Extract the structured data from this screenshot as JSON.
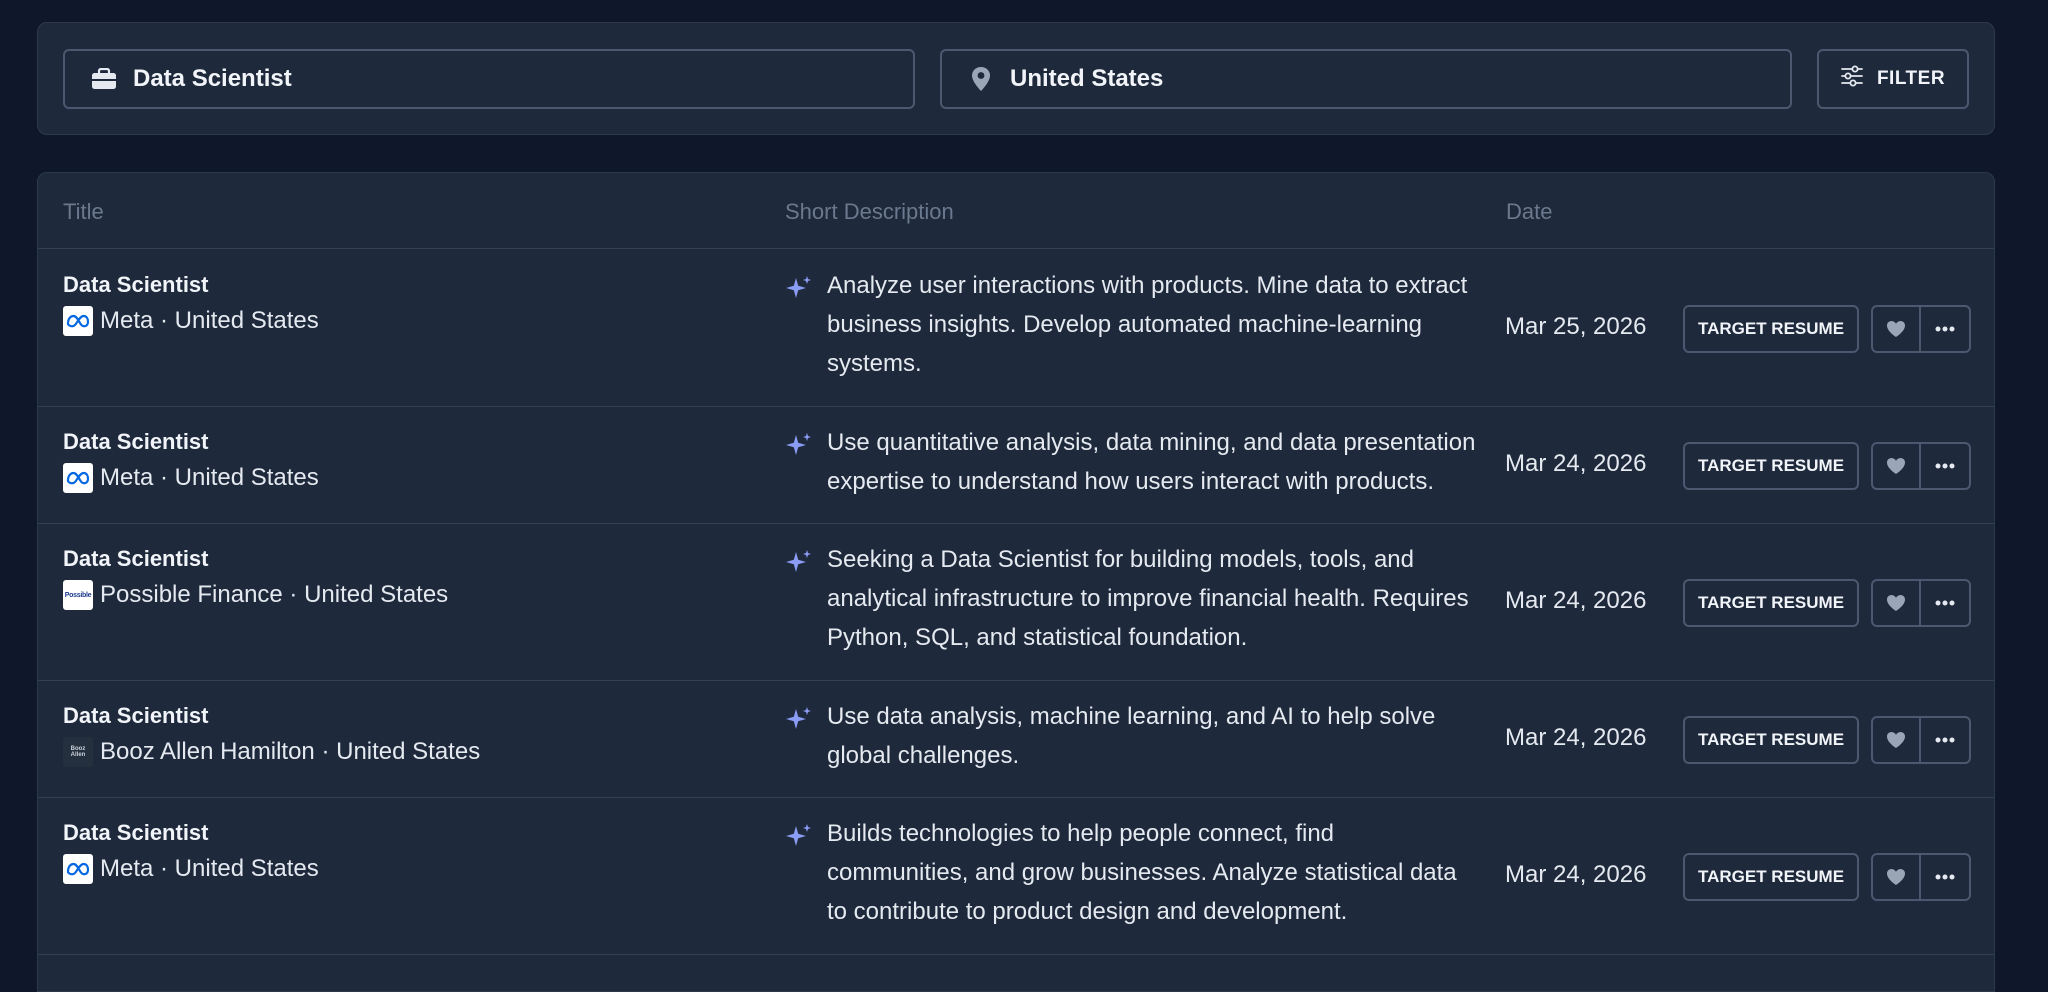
{
  "search": {
    "title_value": "Data Scientist",
    "location_value": "United States",
    "filter_label": "FILTER"
  },
  "table": {
    "headers": {
      "title": "Title",
      "description": "Short Description",
      "date": "Date"
    },
    "rows": [
      {
        "title": "Data Scientist",
        "company": "Meta · United States",
        "logo": "meta-logo",
        "description": "Analyze user interactions with products. Mine data to extract business insights. Develop automated machine-learning systems.",
        "date": "Mar 25, 2026",
        "action_label": "TARGET RESUME"
      },
      {
        "title": "Data Scientist",
        "company": "Meta · United States",
        "logo": "meta-logo",
        "description": "Use quantitative analysis, data mining, and data presentation expertise to understand how users interact with products.",
        "date": "Mar 24, 2026",
        "action_label": "TARGET RESUME"
      },
      {
        "title": "Data Scientist",
        "company": "Possible Finance · United States",
        "logo": "possible-finance-logo",
        "logo_text": "Possible",
        "description": "Seeking a Data Scientist for building models, tools, and analytical infrastructure to improve financial health. Requires Python, SQL, and statistical foundation.",
        "date": "Mar 24, 2026",
        "action_label": "TARGET RESUME"
      },
      {
        "title": "Data Scientist",
        "company": "Booz Allen Hamilton · United States",
        "logo": "booz-allen-logo",
        "logo_text": "Booz Allen",
        "description": "Use data analysis, machine learning, and AI to help solve global challenges.",
        "date": "Mar 24, 2026",
        "action_label": "TARGET RESUME"
      },
      {
        "title": "Data Scientist",
        "company": "Meta · United States",
        "logo": "meta-logo",
        "description": "Builds technologies to help people connect, find communities, and grow businesses. Analyze statistical data to contribute to product design and development.",
        "date": "Mar 24, 2026",
        "action_label": "TARGET RESUME"
      }
    ]
  },
  "icons": {
    "title_field": "briefcase-icon",
    "location_field": "map-pin-icon",
    "filter": "sliders-icon",
    "description": "sparkle-icon",
    "favorite": "heart-icon",
    "more": "more-dots-icon"
  },
  "colors": {
    "background": "#0f172a",
    "panel": "#1e293b",
    "border": "#4b5870",
    "sparkle": "#8b9cf5",
    "meta_blue": "#0668e1"
  }
}
